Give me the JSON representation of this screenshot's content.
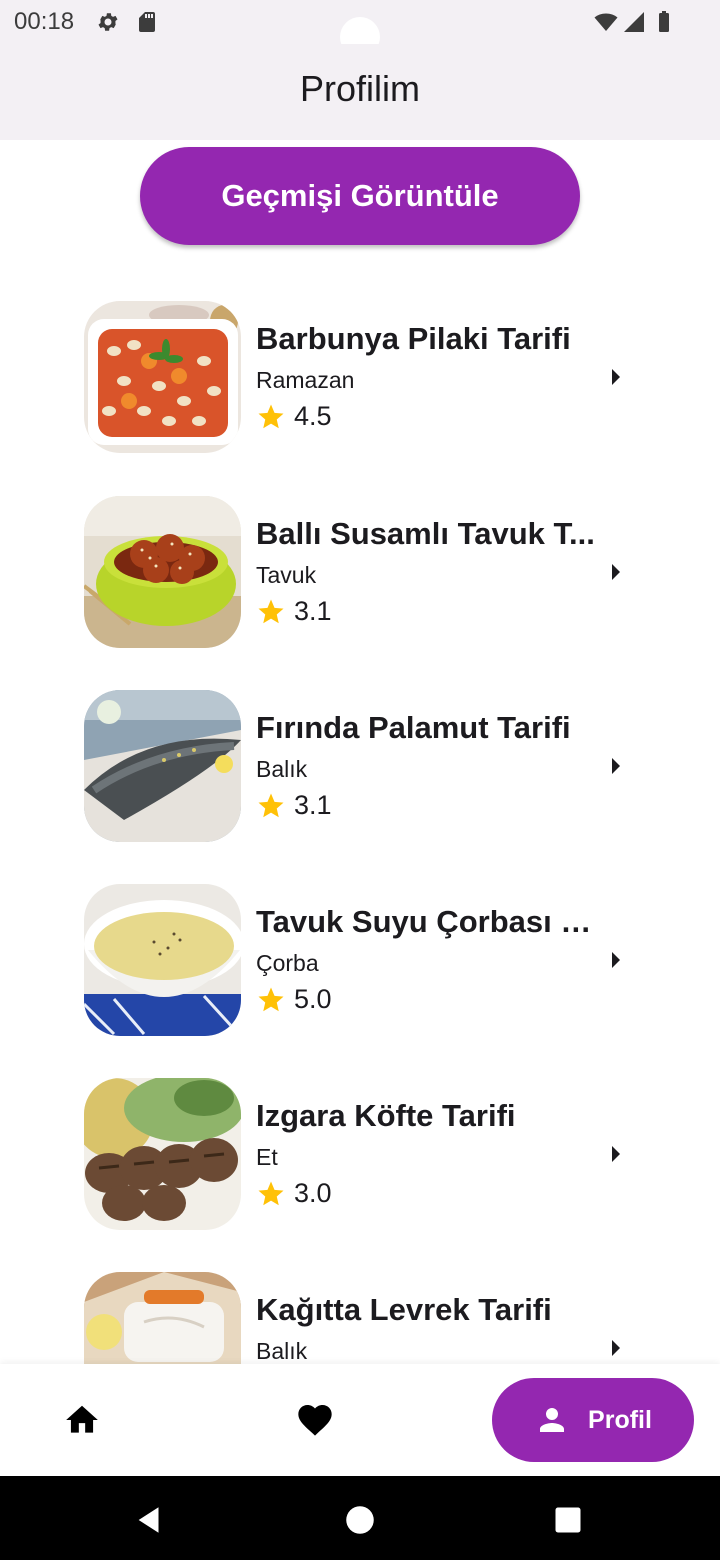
{
  "status_bar": {
    "time": "00:18"
  },
  "app_bar": {
    "title": "Profilim"
  },
  "history_button": {
    "label": "Geçmişi Görüntüle"
  },
  "recipes": [
    {
      "title": "Barbunya Pilaki Tarifi",
      "category": "Ramazan",
      "rating": "4.5"
    },
    {
      "title": "Ballı Susamlı Tavuk T...",
      "category": "Tavuk",
      "rating": "3.1"
    },
    {
      "title": "Fırında Palamut Tarifi",
      "category": "Balık",
      "rating": "3.1"
    },
    {
      "title": "Tavuk Suyu Çorbası T...",
      "category": "Çorba",
      "rating": "5.0"
    },
    {
      "title": "Izgara Köfte Tarifi",
      "category": "Et",
      "rating": "3.0"
    },
    {
      "title": "Kağıtta Levrek Tarifi",
      "category": "Balık",
      "rating": ""
    }
  ],
  "bottom_nav": {
    "profile_label": "Profil"
  },
  "colors": {
    "accent": "#9427b0",
    "star": "#ffc107",
    "appbar": "#f3f0f4"
  }
}
